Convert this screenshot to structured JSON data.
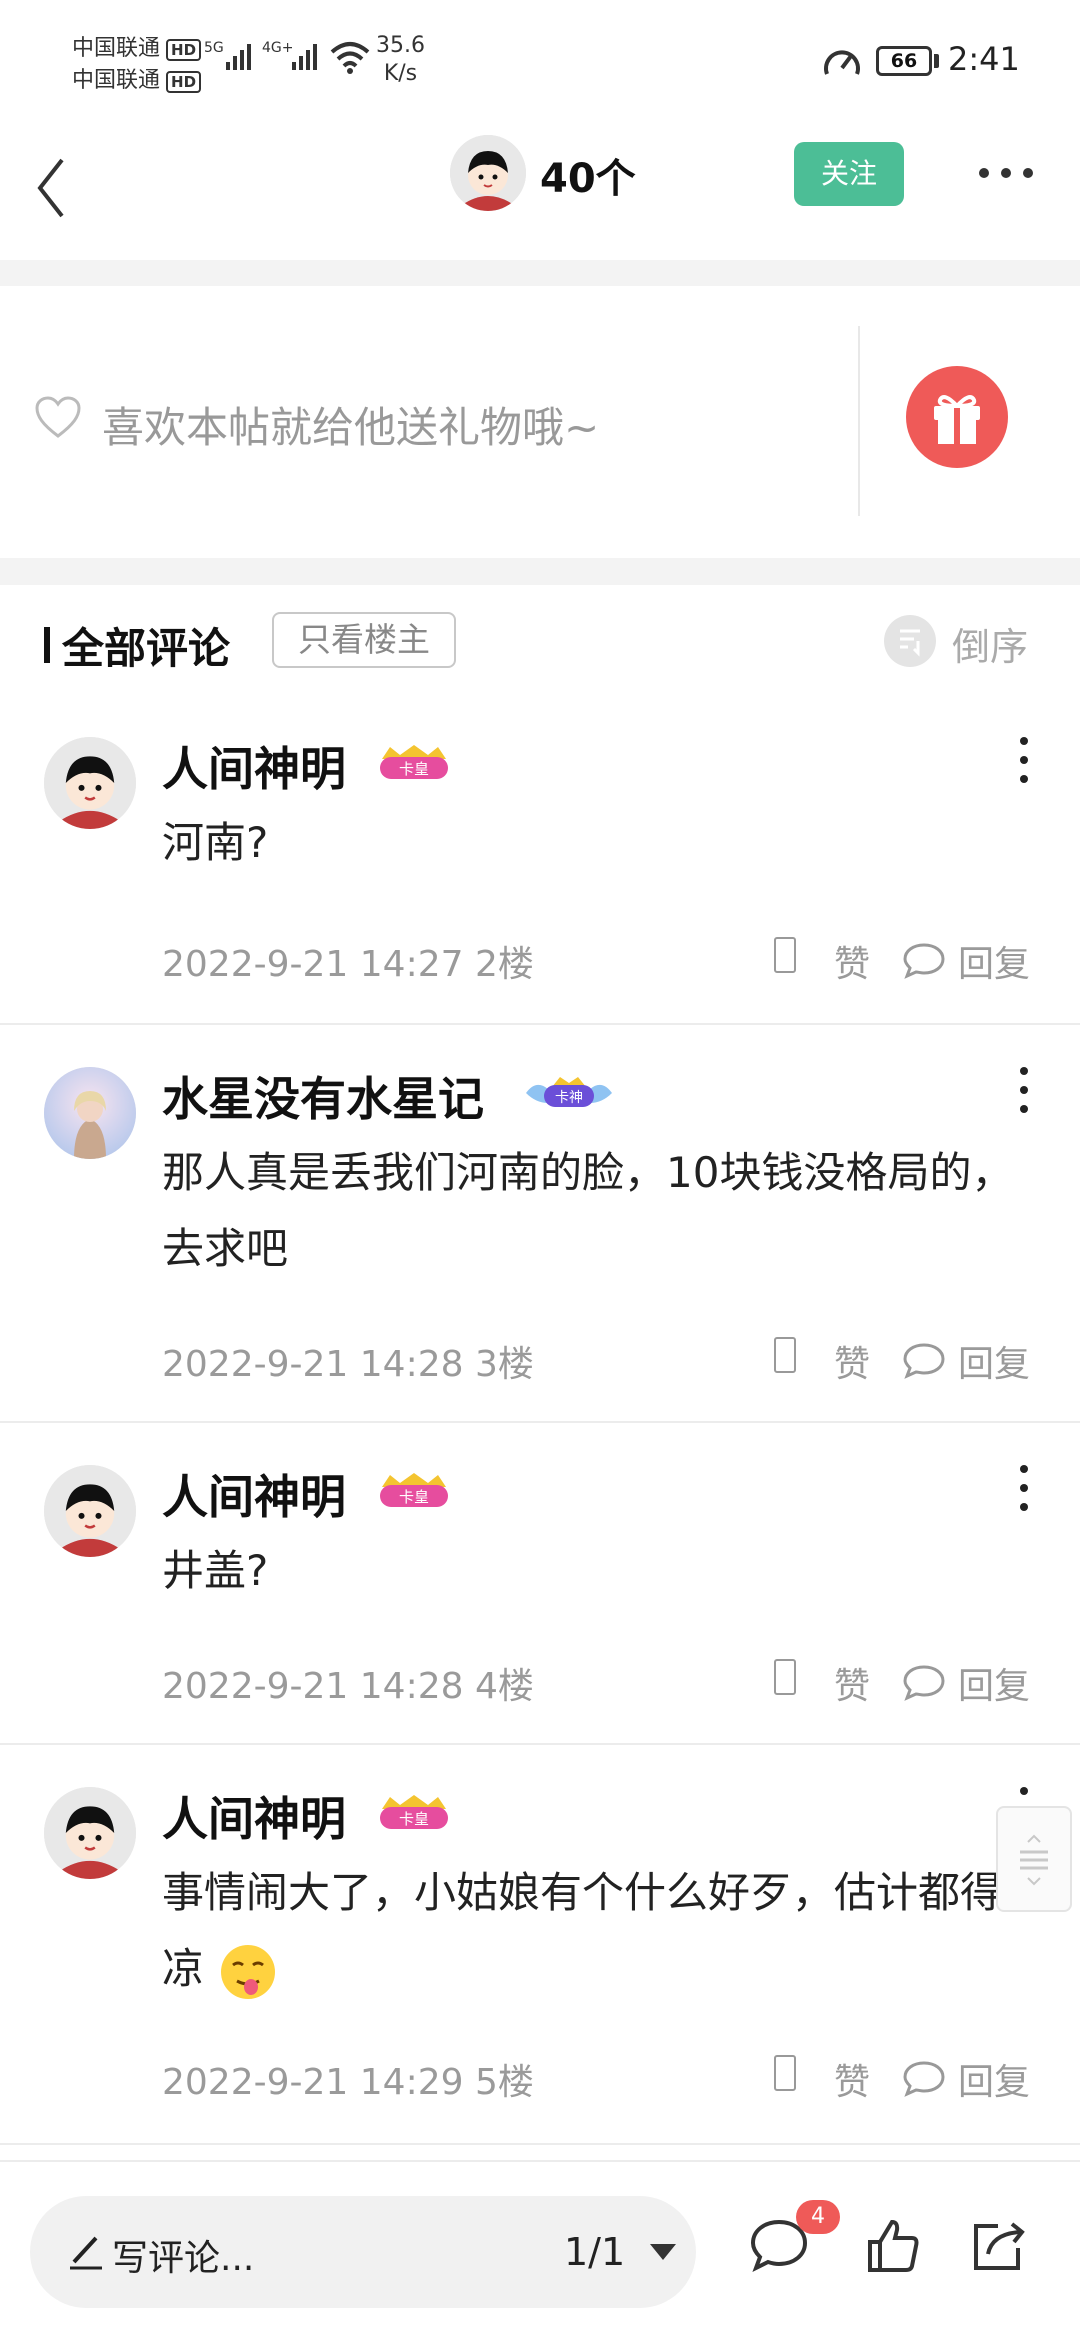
{
  "status_bar": {
    "carrier1": "中国联通",
    "carrier2": "中国联通",
    "hd": "HD",
    "net1": "5G",
    "net2": "4G+",
    "speed_value": "35.6",
    "speed_unit": "K/s",
    "battery": "66",
    "time": "2:41"
  },
  "nav": {
    "title": "40个",
    "follow_label": "关注"
  },
  "gift": {
    "prompt": "喜欢本帖就给他送礼物哦~"
  },
  "comments_header": {
    "title": "全部评论",
    "filter_label": "只看楼主",
    "sort_label": "倒序"
  },
  "comments": [
    {
      "username": "人间神明",
      "badge": "卡皇",
      "text": "河南?",
      "meta": "2022-9-21 14:27  2楼",
      "like_label": "赞",
      "reply_label": "回复"
    },
    {
      "username": "水星没有水星记",
      "badge": "卡神",
      "text": "那人真是丢我们河南的脸，10块钱没格局的，去求吧",
      "meta": "2022-9-21 14:28  3楼",
      "like_label": "赞",
      "reply_label": "回复"
    },
    {
      "username": "人间神明",
      "badge": "卡皇",
      "text": "井盖?",
      "meta": "2022-9-21 14:28  4楼",
      "like_label": "赞",
      "reply_label": "回复"
    },
    {
      "username": "人间神明",
      "badge": "卡皇",
      "text": "事情闹大了，小姑娘有个什么好歹，估计都得凉",
      "meta": "2022-9-21 14:29  5楼",
      "like_label": "赞",
      "reply_label": "回复"
    }
  ],
  "bottom_bar": {
    "input_placeholder": "写评论...",
    "page_indicator": "1/1",
    "comment_count": "4"
  },
  "colors": {
    "accent_green": "#4cbe96",
    "gift_red": "#ef5a58",
    "badge_pink": "#e64d9e",
    "badge_purple": "#6b4fd8"
  }
}
